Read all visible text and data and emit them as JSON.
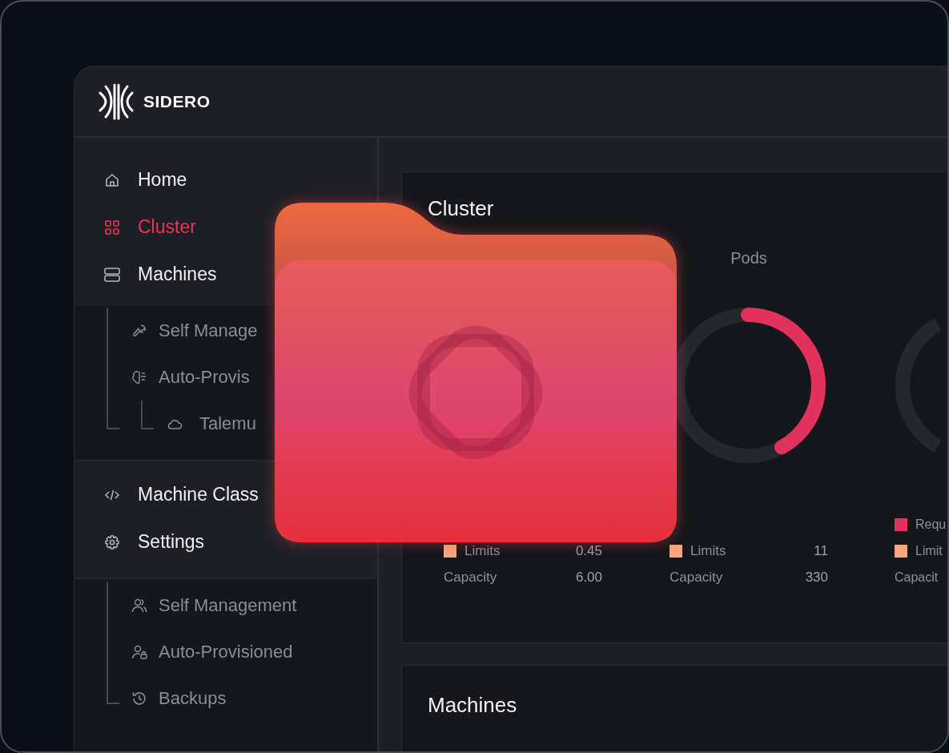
{
  "brand": {
    "name": "SIDERO"
  },
  "sidebar": {
    "sections": [
      {
        "items": [
          {
            "label": "Home",
            "selected": false
          },
          {
            "label": "Cluster",
            "selected": true
          },
          {
            "label": "Machines",
            "selected": false,
            "children": [
              {
                "label": "Self Manage"
              },
              {
                "label": "Auto-Provis",
                "children": [
                  {
                    "label": "Talemu"
                  }
                ]
              }
            ]
          }
        ]
      },
      {
        "items": [
          {
            "label": "Machine Class",
            "selected": false
          },
          {
            "label": "Settings",
            "selected": false,
            "children": [
              {
                "label": "Self Management"
              },
              {
                "label": "Auto-Provisioned"
              },
              {
                "label": "Backups"
              }
            ]
          }
        ]
      }
    ]
  },
  "cluster_card": {
    "title": "Cluster",
    "columns": [
      {
        "kind": "legend-only",
        "legend": [
          {
            "label": "Limits",
            "color": "#f8a47c",
            "value": "0.45"
          },
          {
            "label": "Capacity",
            "value": "6.00"
          }
        ]
      },
      {
        "kind": "gauge",
        "title": "Pods",
        "level": 0.42,
        "legend": [
          {
            "label": "Limits",
            "color": "#f8a47c",
            "value": "11"
          },
          {
            "label": "Capacity",
            "value": "330"
          }
        ]
      },
      {
        "kind": "gauge-edge",
        "legend": [
          {
            "label": "Requ",
            "color": "#e0325a"
          },
          {
            "label": "Limit",
            "color": "#f8a47c"
          },
          {
            "label": "Capacit"
          }
        ]
      }
    ]
  },
  "machines_card": {
    "title": "Machines"
  }
}
